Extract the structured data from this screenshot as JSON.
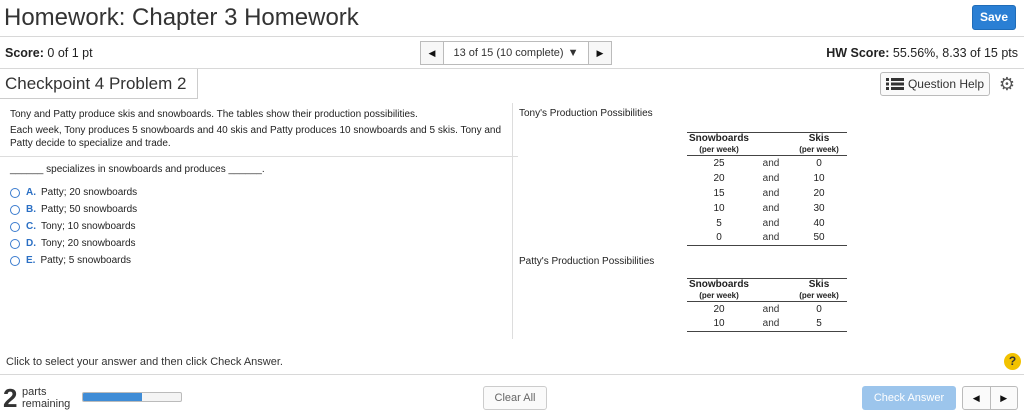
{
  "header": {
    "title": "Homework: Chapter 3 Homework",
    "save_label": "Save"
  },
  "scorebar": {
    "score_label": "Score:",
    "score_value": "0 of 1 pt",
    "question_select": "13 of 15 (10 complete)",
    "hw_score_label": "HW Score:",
    "hw_score_value": "55.56%, 8.33 of 15 pts"
  },
  "problem": {
    "title": "Checkpoint 4 Problem 2",
    "question_help_label": "Question Help",
    "intro": "Tony and Patty produce skis and snowboards. The tables show their production possibilities.",
    "details": "Each week, Tony produces 5 snowboards and 40 skis and Patty produces 10 snowboards and 5 skis. Tony and Patty decide to specialize and trade.",
    "prompt": "______ specializes in snowboards and produces ______.",
    "options": [
      {
        "letter": "A.",
        "text": "Patty; 20 snowboards"
      },
      {
        "letter": "B.",
        "text": "Patty; 50 snowboards"
      },
      {
        "letter": "C.",
        "text": "Tony; 10 snowboards"
      },
      {
        "letter": "D.",
        "text": "Tony; 20 snowboards"
      },
      {
        "letter": "E.",
        "text": "Patty; 5 snowboards"
      }
    ]
  },
  "tables": {
    "tony": {
      "title": "Tony's Production Possibilities",
      "col1": "Snowboards",
      "col1_sub": "(per week)",
      "col2": "Skis",
      "col2_sub": "(per week)",
      "rows": [
        [
          "25",
          "and",
          "0"
        ],
        [
          "20",
          "and",
          "10"
        ],
        [
          "15",
          "and",
          "20"
        ],
        [
          "10",
          "and",
          "30"
        ],
        [
          "5",
          "and",
          "40"
        ],
        [
          "0",
          "and",
          "50"
        ]
      ]
    },
    "patty": {
      "title": "Patty's Production Possibilities",
      "col1": "Snowboards",
      "col1_sub": "(per week)",
      "col2": "Skis",
      "col2_sub": "(per week)",
      "rows": [
        [
          "20",
          "and",
          "0"
        ],
        [
          "10",
          "and",
          "5"
        ]
      ]
    }
  },
  "footer": {
    "instruction": "Click to select your answer and then click Check Answer.",
    "parts_count": "2",
    "parts_label_1": "parts",
    "parts_label_2": "remaining",
    "progress_fraction": 0.6,
    "clear_all_label": "Clear All",
    "check_answer_label": "Check Answer"
  },
  "colors": {
    "accent": "#2a7fd4",
    "check_button": "#9cc5ec",
    "help_icon": "#f2c200"
  },
  "icons": [
    "left-arrow-icon",
    "right-arrow-icon",
    "dropdown-caret-icon",
    "list-icon",
    "gear-icon",
    "help-icon"
  ]
}
